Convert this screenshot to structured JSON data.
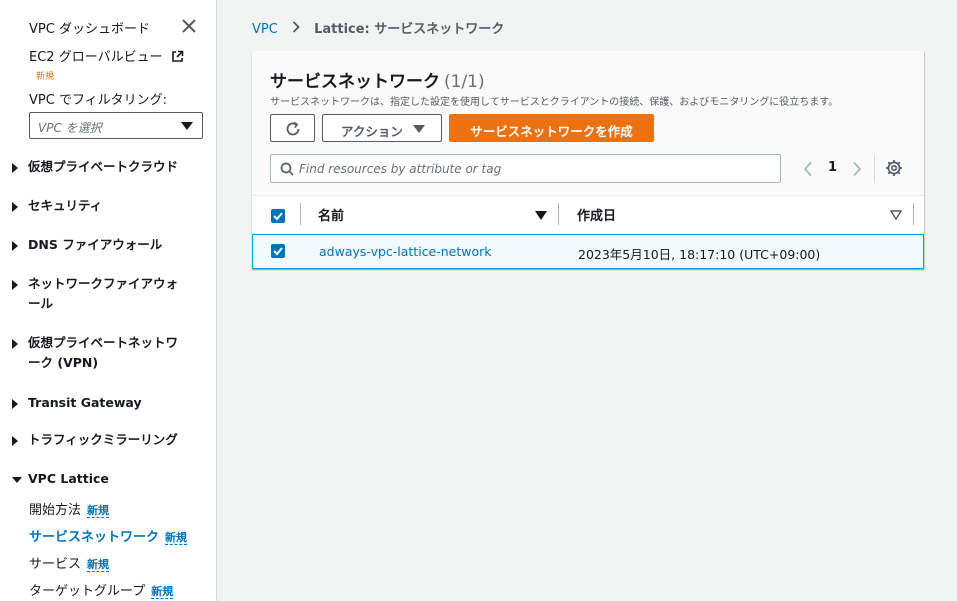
{
  "sidebar": {
    "dashboard": "VPC ダッシュボード",
    "global_view": "EC2 グローバルビュー",
    "global_view_badge": "新規",
    "filter_label": "VPC でフィルタリング:",
    "filter_placeholder": "VPC を選択",
    "sections": [
      {
        "label": "仮想プライベートクラウド",
        "expanded": false
      },
      {
        "label": "セキュリティ",
        "expanded": false
      },
      {
        "label": "DNS ファイアウォール",
        "expanded": false
      },
      {
        "label": "ネットワークファイアウォール",
        "expanded": false
      },
      {
        "label": "仮想プライベートネットワーク (VPN)",
        "expanded": false
      },
      {
        "label": "Transit Gateway",
        "expanded": false
      },
      {
        "label": "トラフィックミラーリング",
        "expanded": false
      },
      {
        "label": "VPC Lattice",
        "expanded": true
      }
    ],
    "lattice_items": [
      {
        "label": "開始方法",
        "badge": "新規",
        "active": false
      },
      {
        "label": "サービスネットワーク",
        "badge": "新規",
        "active": true
      },
      {
        "label": "サービス",
        "badge": "新規",
        "active": false
      },
      {
        "label": "ターゲットグループ",
        "badge": "新規",
        "active": false
      }
    ]
  },
  "breadcrumb": {
    "root": "VPC",
    "current": "Lattice: サービスネットワーク"
  },
  "panel": {
    "title": "サービスネットワーク",
    "count": "(1/1)",
    "description": "サービスネットワークは、指定した設定を使用してサービスとクライアントの接続、保護、およびモニタリングに役立ちます。",
    "action_label": "アクション",
    "create_label": "サービスネットワークを作成",
    "search_placeholder": "Find resources by attribute or tag",
    "page": "1",
    "columns": [
      "名前",
      "作成日"
    ],
    "rows": [
      {
        "name": "adways-vpc-lattice-network",
        "created": "2023年5月10日, 18:17:10 (UTC+09:00)",
        "selected": true
      }
    ]
  },
  "colors": {
    "accent": "#0073bb",
    "primary_button": "#ec7211",
    "new_small": "#ec7211"
  }
}
